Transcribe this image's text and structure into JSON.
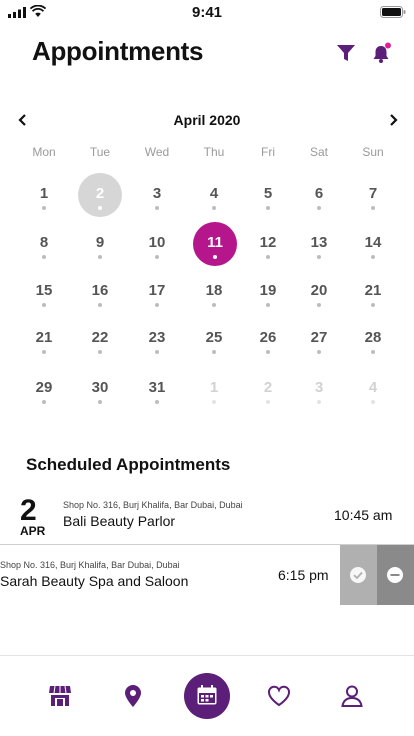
{
  "status_bar": {
    "time": "9:41"
  },
  "header": {
    "title": "Appointments",
    "icons": [
      "filter-icon",
      "bell-icon"
    ],
    "accent_color": "#5b1e79"
  },
  "calendar": {
    "month_label": "April 2020",
    "weekdays": [
      "Mon",
      "Tue",
      "Wed",
      "Thu",
      "Fri",
      "Sat",
      "Sun"
    ],
    "weeks": [
      [
        "1",
        "2",
        "3",
        "4",
        "5",
        "6",
        "7"
      ],
      [
        "8",
        "9",
        "10",
        "11",
        "12",
        "13",
        "14"
      ],
      [
        "15",
        "16",
        "17",
        "18",
        "19",
        "20",
        "21"
      ],
      [
        "21",
        "22",
        "23",
        "25",
        "26",
        "27",
        "28"
      ],
      [
        "29",
        "30",
        "31",
        "1",
        "2",
        "3",
        "4"
      ]
    ],
    "today": "2",
    "selected": "11",
    "selected_color": "#b5168c"
  },
  "scheduled": {
    "title": "Scheduled Appointments",
    "items": [
      {
        "day": "2",
        "month": "APR",
        "address": "Shop No. 316, Burj Khalifa, Bar Dubai, Dubai",
        "name": "Bali Beauty Parlor",
        "time": "10:45 am"
      },
      {
        "address": "Shop No. 316, Burj Khalifa, Bar Dubai, Dubai",
        "name": "Sarah Beauty Spa and Saloon",
        "time": "6:15 pm"
      }
    ]
  },
  "bottom_nav": {
    "items": [
      "store-icon",
      "location-pin-icon",
      "calendar-icon",
      "heart-icon",
      "profile-icon"
    ],
    "active": "calendar-icon"
  }
}
